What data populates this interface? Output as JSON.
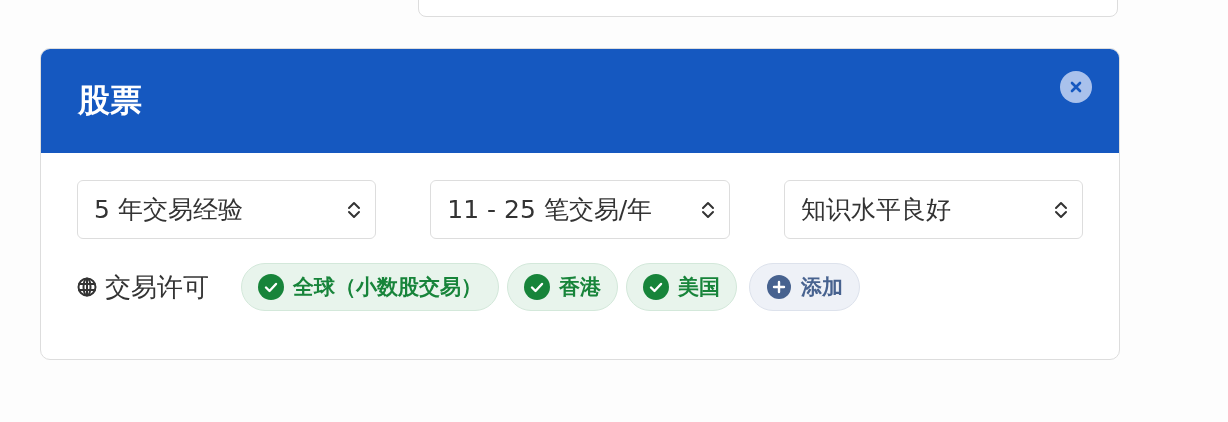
{
  "panel": {
    "title": "股票"
  },
  "selects": [
    {
      "value": "5 年交易经验"
    },
    {
      "value": "11 - 25 笔交易/年"
    },
    {
      "value": "知识水平良好"
    }
  ],
  "permits": {
    "label": "交易许可",
    "tags": [
      {
        "kind": "permit",
        "label": "全球（小数股交易）"
      },
      {
        "kind": "permit",
        "label": "香港"
      },
      {
        "kind": "permit",
        "label": "美国"
      },
      {
        "kind": "add",
        "label": "添加"
      }
    ]
  }
}
